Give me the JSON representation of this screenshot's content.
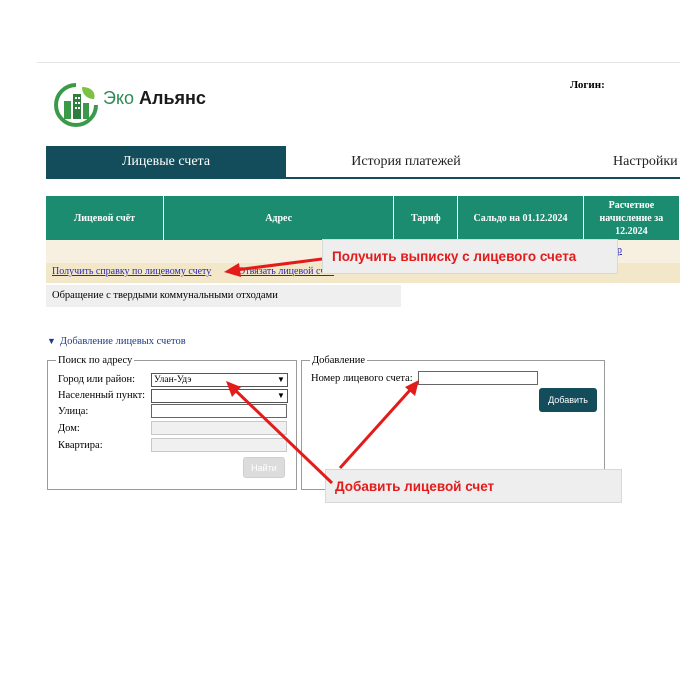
{
  "logo": {
    "part1": "Эко",
    "part2": "Альянс"
  },
  "header": {
    "login_label": "Логин:"
  },
  "tabs": [
    {
      "label": "Лицевые счета"
    },
    {
      "label": "История платежей"
    },
    {
      "label": "Настройки"
    }
  ],
  "table": {
    "headers": [
      "Лицевой счёт",
      "Адрес",
      "Тариф",
      "Сальдо на 01.12.2024",
      "Расчетное начисление за 12.2024"
    ],
    "partial_cell_fragment": "р"
  },
  "links": {
    "get_certificate": "Получить справку по лицевому счету",
    "unlink_account": "Отвязать лицевой счет"
  },
  "solid_waste_row": "Обращение с твердыми коммунальными отходами",
  "callouts": {
    "statement": "Получить выписку с лицевого счета",
    "add_account": "Добавить лицевой счет"
  },
  "add_section": {
    "title": "Добавление лицевых счетов",
    "search_by_address": {
      "legend": "Поиск по адресу",
      "city_label": "Город или район:",
      "city_value": "Улан-Удэ",
      "settlement_label": "Населенный пункт:",
      "settlement_value": "",
      "street_label": "Улица:",
      "house_label": "Дом:",
      "apartment_label": "Квартира:",
      "find_button": "Найти"
    },
    "add_form": {
      "legend": "Добавление",
      "account_number_label": "Номер лицевого счета:",
      "account_number_value": "",
      "add_button": "Добавить"
    }
  },
  "colors": {
    "tab_active": "#134d5c",
    "table_header": "#1b8c70",
    "callout_text": "#e21b1b",
    "arrow": "#e31b1b",
    "link": "#2a2ab5"
  }
}
